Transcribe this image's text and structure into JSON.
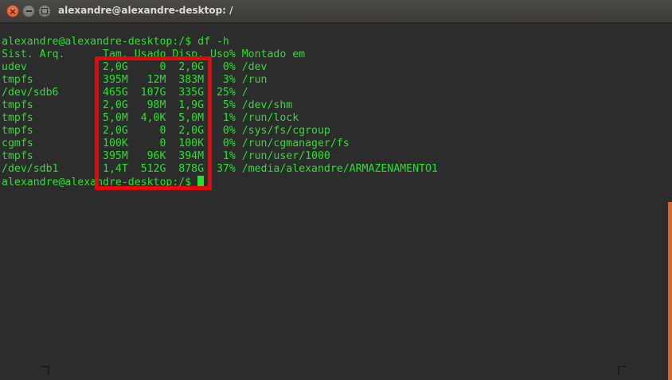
{
  "window": {
    "title": "alexandre@alexandre-desktop: /",
    "close_glyph": "×",
    "icons": {
      "close": "close-icon",
      "minimize": "minimize-icon",
      "maximize": "maximize-icon"
    }
  },
  "terminal": {
    "text_color": "#27e22b",
    "background": "#2c2c2c",
    "highlight_color": "#e8060a",
    "scrollbar_color": "#d9662e",
    "command_line": "alexandre@alexandre-desktop:/$ df -h",
    "header": "Sist. Arq.      Tam. Usado Disp. Uso% Montado em",
    "rows": [
      "udev            2,0G     0  2,0G   0% /dev",
      "tmpfs           395M   12M  383M   3% /run",
      "/dev/sdb6       465G  107G  335G  25% /",
      "tmpfs           2,0G   98M  1,9G   5% /dev/shm",
      "tmpfs           5,0M  4,0K  5,0M   1% /run/lock",
      "tmpfs           2,0G     0  2,0G   0% /sys/fs/cgroup",
      "cgmfs           100K     0  100K   0% /run/cgmanager/fs",
      "tmpfs           395M   96K  394M   1% /run/user/1000",
      "/dev/sdb1       1,4T  512G  878G  37% /media/alexandre/ARMAZENAMENTO1"
    ],
    "prompt": "alexandre@alexandre-desktop:/$ "
  }
}
